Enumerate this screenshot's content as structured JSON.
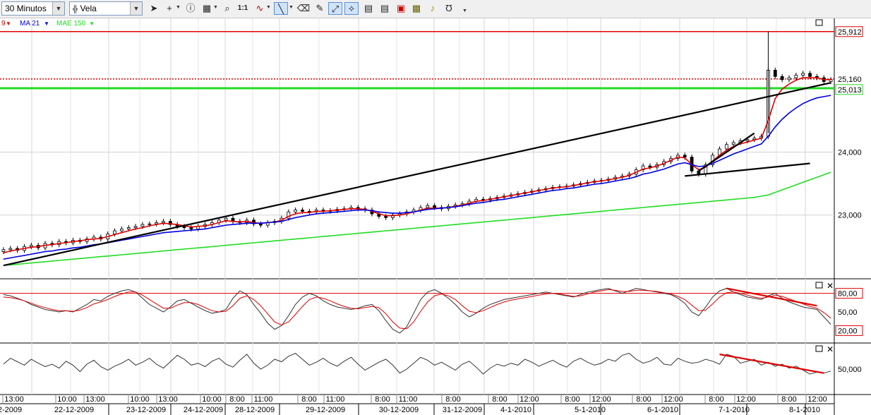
{
  "toolbar": {
    "timeframe": "30 Minutos",
    "chart_style": "Vela",
    "icons": [
      "pointer-icon",
      "crosshair-icon",
      "info-icon",
      "grid-icon",
      "zoom-icon",
      "one-to-one-icon",
      "indicator-icon",
      "line-tool-icon",
      "eraser-icon",
      "paint-icon",
      "autoscale-icon",
      "magnet-icon",
      "template1-icon",
      "template2-icon",
      "template3-icon",
      "drawing-icon",
      "alarm-icon",
      "undo-icon",
      "more-icon"
    ],
    "one_to_one_label": "1:1"
  },
  "legend": {
    "item1": "9",
    "item2": "MA 21",
    "item3": "MAE 150"
  },
  "colors": {
    "price_red": "#e00000",
    "ma21_blue": "#0000e0",
    "mae150_green": "#22dd22",
    "level_green": "#22dd22",
    "trend_black": "#000000",
    "grid": "#d4d4d4"
  },
  "chart_data": [
    {
      "type": "candlestick",
      "panel": "price",
      "y_ticks": [
        "25,912",
        "25,160",
        "25,013",
        "24,000",
        "23,000"
      ],
      "y_tick_values": [
        25.912,
        25.16,
        25.013,
        24.0,
        23.0
      ],
      "ylim": [
        22.0,
        26.1
      ],
      "time_labels": [
        "13:00",
        "10:00",
        "13:00",
        "10:00",
        "13:00",
        "10:00",
        "8:00",
        "11:00",
        "8:00",
        "11:00",
        "8:00",
        "11:00",
        "8:00",
        "8:00",
        "12:00",
        "8:00",
        "12:00",
        "8:00",
        "12:00",
        "8:00",
        "12:00",
        "8:00",
        "12:00"
      ],
      "date_labels": [
        "2-2009",
        "22-12-2009",
        "23-12-2009",
        "24-12-2009",
        "28-12-2009",
        "29-12-2009",
        "30-12-2009",
        "31-12-2009",
        "4-1-2010",
        "5-1-2010",
        "6-1-2010",
        "7-1-2010",
        "8-1-2010"
      ],
      "horizontal_levels": [
        {
          "value": 25.912,
          "color": "#e00000",
          "style": "solid"
        },
        {
          "value": 25.16,
          "color": "#e00000",
          "style": "dotted"
        },
        {
          "value": 25.013,
          "color": "#22dd22",
          "style": "solid"
        }
      ],
      "close": [
        22.45,
        22.47,
        22.44,
        22.5,
        22.52,
        22.48,
        22.55,
        22.53,
        22.58,
        22.56,
        22.6,
        22.58,
        22.62,
        22.65,
        22.62,
        22.7,
        22.75,
        22.78,
        22.8,
        22.82,
        22.85,
        22.86,
        22.88,
        22.9,
        22.85,
        22.82,
        22.8,
        22.78,
        22.82,
        22.85,
        22.88,
        22.92,
        22.95,
        22.9,
        22.88,
        22.92,
        22.86,
        22.84,
        22.88,
        22.9,
        22.95,
        23.05,
        23.08,
        23.06,
        23.05,
        23.08,
        23.06,
        23.07,
        23.09,
        23.1,
        23.12,
        23.1,
        23.08,
        23.02,
        22.98,
        22.96,
        23.0,
        23.02,
        23.05,
        23.08,
        23.12,
        23.15,
        23.12,
        23.1,
        23.14,
        23.16,
        23.18,
        23.22,
        23.25,
        23.24,
        23.26,
        23.28,
        23.3,
        23.32,
        23.34,
        23.36,
        23.38,
        23.4,
        23.42,
        23.44,
        23.45,
        23.46,
        23.48,
        23.5,
        23.52,
        23.54,
        23.55,
        23.57,
        23.6,
        23.62,
        23.65,
        23.72,
        23.78,
        23.76,
        23.8,
        23.85,
        23.9,
        23.95,
        23.92,
        23.7,
        23.65,
        23.8,
        23.95,
        24.05,
        24.12,
        24.15,
        24.18,
        24.2,
        24.22,
        24.25,
        25.3,
        25.2,
        25.15,
        25.18,
        25.22,
        25.25,
        25.2,
        25.18,
        25.12,
        25.15
      ],
      "series": [
        {
          "name": "9",
          "values": [
            22.4,
            22.43,
            22.45,
            22.47,
            22.49,
            22.5,
            22.52,
            22.53,
            22.55,
            22.56,
            22.58,
            22.59,
            22.61,
            22.62,
            22.63,
            22.66,
            22.69,
            22.72,
            22.75,
            22.78,
            22.8,
            22.83,
            22.85,
            22.87,
            22.86,
            22.85,
            22.83,
            22.81,
            22.82,
            22.83,
            22.85,
            22.88,
            22.91,
            22.9,
            22.89,
            22.9,
            22.88,
            22.87,
            22.88,
            22.89,
            22.92,
            22.98,
            23.02,
            23.04,
            23.04,
            23.06,
            23.06,
            23.07,
            23.08,
            23.09,
            23.1,
            23.1,
            23.09,
            23.06,
            23.02,
            22.99,
            22.99,
            23.0,
            23.02,
            23.05,
            23.08,
            23.11,
            23.11,
            23.11,
            23.12,
            23.14,
            23.16,
            23.19,
            23.22,
            23.23,
            23.25,
            23.27,
            23.29,
            23.31,
            23.33,
            23.35,
            23.37,
            23.39,
            23.41,
            23.43,
            23.44,
            23.45,
            23.47,
            23.49,
            23.51,
            23.53,
            23.54,
            23.56,
            23.58,
            23.6,
            23.63,
            23.68,
            23.73,
            23.75,
            23.78,
            23.82,
            23.87,
            23.92,
            23.91,
            23.8,
            23.72,
            23.76,
            23.86,
            23.95,
            24.03,
            24.09,
            24.13,
            24.16,
            24.19,
            24.22,
            24.5,
            24.85,
            25.0,
            25.08,
            25.14,
            25.18,
            25.18,
            25.18,
            25.15,
            25.15
          ]
        },
        {
          "name": "MA 21",
          "values": [
            22.3,
            22.32,
            22.34,
            22.36,
            22.38,
            22.4,
            22.42,
            22.43,
            22.45,
            22.46,
            22.48,
            22.49,
            22.51,
            22.53,
            22.54,
            22.56,
            22.58,
            22.6,
            22.62,
            22.64,
            22.66,
            22.68,
            22.7,
            22.72,
            22.73,
            22.74,
            22.75,
            22.76,
            22.77,
            22.78,
            22.8,
            22.82,
            22.84,
            22.85,
            22.86,
            22.87,
            22.87,
            22.87,
            22.88,
            22.89,
            22.9,
            22.93,
            22.96,
            22.98,
            23.0,
            23.02,
            23.03,
            23.04,
            23.05,
            23.06,
            23.07,
            23.08,
            23.08,
            23.07,
            23.05,
            23.04,
            23.03,
            23.03,
            23.04,
            23.05,
            23.07,
            23.09,
            23.1,
            23.11,
            23.12,
            23.13,
            23.15,
            23.17,
            23.19,
            23.2,
            23.22,
            23.24,
            23.25,
            23.27,
            23.29,
            23.31,
            23.33,
            23.35,
            23.37,
            23.39,
            23.4,
            23.42,
            23.43,
            23.45,
            23.47,
            23.49,
            23.5,
            23.52,
            23.54,
            23.56,
            23.58,
            23.61,
            23.65,
            23.67,
            23.7,
            23.73,
            23.77,
            23.81,
            23.83,
            23.8,
            23.77,
            23.78,
            23.82,
            23.87,
            23.92,
            23.97,
            24.01,
            24.05,
            24.09,
            24.13,
            24.25,
            24.4,
            24.52,
            24.62,
            24.7,
            24.77,
            24.82,
            24.86,
            24.88,
            24.9
          ]
        },
        {
          "name": "MAE 150",
          "values": [
            22.2,
            22.21,
            22.22,
            22.23,
            22.24,
            22.25,
            22.26,
            22.27,
            22.28,
            22.29,
            22.3,
            22.31,
            22.32,
            22.33,
            22.34,
            22.35,
            22.36,
            22.37,
            22.38,
            22.39,
            22.4,
            22.41,
            22.42,
            22.43,
            22.44,
            22.45,
            22.46,
            22.47,
            22.48,
            22.49,
            22.5,
            22.51,
            22.52,
            22.53,
            22.54,
            22.55,
            22.56,
            22.57,
            22.58,
            22.59,
            22.6,
            22.61,
            22.62,
            22.63,
            22.64,
            22.65,
            22.66,
            22.67,
            22.68,
            22.69,
            22.7,
            22.71,
            22.72,
            22.73,
            22.74,
            22.75,
            22.76,
            22.77,
            22.78,
            22.79,
            22.8,
            22.81,
            22.82,
            22.83,
            22.84,
            22.85,
            22.86,
            22.87,
            22.88,
            22.89,
            22.9,
            22.91,
            22.92,
            22.93,
            22.94,
            22.95,
            22.96,
            22.97,
            22.98,
            22.99,
            23.0,
            23.01,
            23.02,
            23.03,
            23.04,
            23.05,
            23.06,
            23.07,
            23.08,
            23.09,
            23.1,
            23.11,
            23.12,
            23.13,
            23.14,
            23.15,
            23.16,
            23.17,
            23.18,
            23.19,
            23.2,
            23.21,
            23.22,
            23.23,
            23.24,
            23.25,
            23.26,
            23.27,
            23.28,
            23.3,
            23.32,
            23.36,
            23.4,
            23.44,
            23.48,
            23.52,
            23.56,
            23.6,
            23.64,
            23.68
          ]
        }
      ],
      "trendlines": [
        {
          "color": "#000000",
          "from": [
            0,
            22.2
          ],
          "to": [
            119,
            25.1
          ]
        },
        {
          "color": "#000000",
          "from": [
            98,
            23.62
          ],
          "to": [
            116,
            23.82
          ]
        },
        {
          "color": "#000000",
          "from": [
            100,
            23.7
          ],
          "to": [
            108,
            24.3
          ]
        }
      ]
    },
    {
      "type": "line",
      "panel": "oscillator1",
      "y_ticks": [
        "80,00",
        "50,00",
        "20,00"
      ],
      "y_tick_values": [
        80,
        50,
        20
      ],
      "ylim": [
        0,
        100
      ],
      "reference_line": {
        "value": 80,
        "color": "#e00000"
      },
      "series": [
        {
          "values": [
            78,
            76,
            72,
            68,
            62,
            58,
            54,
            52,
            50,
            52,
            50,
            56,
            62,
            70,
            68,
            75,
            80,
            84,
            86,
            82,
            72,
            62,
            56,
            50,
            58,
            68,
            70,
            64,
            58,
            52,
            48,
            50,
            54,
            72,
            84,
            78,
            62,
            48,
            32,
            22,
            28,
            44,
            62,
            74,
            80,
            76,
            68,
            62,
            58,
            56,
            54,
            56,
            60,
            62,
            52,
            36,
            22,
            16,
            26,
            48,
            70,
            82,
            86,
            80,
            72,
            62,
            50,
            42,
            48,
            56,
            62,
            66,
            70,
            72,
            74,
            76,
            78,
            80,
            82,
            80,
            78,
            76,
            74,
            78,
            82,
            84,
            86,
            88,
            84,
            80,
            84,
            88,
            86,
            84,
            82,
            80,
            78,
            72,
            64,
            50,
            44,
            58,
            74,
            84,
            88,
            82,
            78,
            74,
            72,
            70,
            76,
            80,
            72,
            66,
            62,
            58,
            56,
            54,
            42,
            30
          ]
        },
        {
          "values": [
            74,
            73,
            71,
            68,
            64,
            60,
            57,
            54,
            52,
            52,
            51,
            53,
            57,
            63,
            66,
            70,
            75,
            79,
            82,
            82,
            77,
            70,
            63,
            56,
            56,
            61,
            65,
            65,
            62,
            57,
            52,
            50,
            51,
            60,
            72,
            76,
            70,
            60,
            47,
            34,
            29,
            34,
            46,
            59,
            70,
            74,
            72,
            68,
            63,
            59,
            56,
            55,
            57,
            59,
            57,
            47,
            34,
            24,
            23,
            34,
            51,
            66,
            76,
            79,
            76,
            70,
            60,
            51,
            49,
            52,
            57,
            62,
            66,
            69,
            71,
            73,
            75,
            77,
            79,
            80,
            79,
            77,
            75,
            76,
            79,
            82,
            84,
            86,
            85,
            83,
            83,
            85,
            85,
            84,
            83,
            81,
            79,
            75,
            70,
            61,
            52,
            53,
            63,
            74,
            81,
            82,
            80,
            77,
            74,
            72,
            74,
            77,
            75,
            71,
            67,
            63,
            59,
            56,
            49,
            40
          ]
        }
      ],
      "trendline": {
        "color": "#e00000",
        "from": [
          104,
          88
        ],
        "to": [
          117,
          60
        ]
      }
    },
    {
      "type": "line",
      "panel": "oscillator2",
      "y_ticks": [
        "50,000"
      ],
      "y_tick_values": [
        50
      ],
      "ylim": [
        0,
        100
      ],
      "series": [
        {
          "values": [
            60,
            72,
            65,
            58,
            70,
            62,
            55,
            60,
            52,
            66,
            58,
            45,
            60,
            68,
            55,
            48,
            56,
            62,
            70,
            58,
            64,
            72,
            60,
            52,
            65,
            78,
            70,
            58,
            62,
            55,
            66,
            72,
            60,
            54,
            68,
            80,
            62,
            50,
            58,
            70,
            65,
            76,
            82,
            70,
            58,
            64,
            72,
            62,
            56,
            66,
            74,
            60,
            48,
            56,
            64,
            70,
            58,
            42,
            50,
            62,
            74,
            68,
            58,
            64,
            56,
            48,
            60,
            66,
            54,
            40,
            52,
            60,
            56,
            62,
            58,
            70,
            64,
            56,
            62,
            68,
            60,
            54,
            66,
            72,
            64,
            58,
            62,
            70,
            66,
            78,
            82,
            70,
            62,
            66,
            74,
            60,
            58,
            72,
            66,
            62,
            64,
            70,
            66,
            60,
            80,
            76,
            62,
            66,
            70,
            58,
            64,
            56,
            60,
            52,
            56,
            48,
            40,
            44,
            42,
            46
          ]
        }
      ],
      "trendline": {
        "color": "#e00000",
        "from": [
          103,
          80
        ],
        "to": [
          118,
          42
        ]
      }
    }
  ]
}
